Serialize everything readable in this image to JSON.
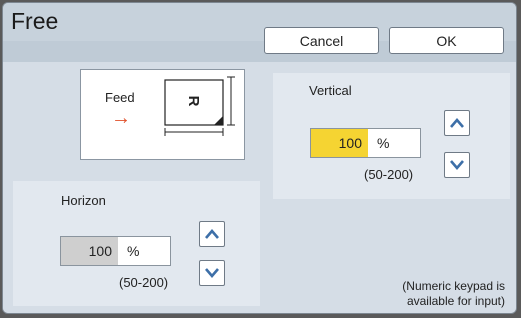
{
  "dialog": {
    "title": "Free",
    "cancel_label": "Cancel",
    "ok_label": "OK"
  },
  "diagram": {
    "feed_label": "Feed",
    "feed_arrow": "→",
    "paper_letter": "R"
  },
  "vertical": {
    "label": "Vertical",
    "value": "100",
    "unit": "%",
    "range": "(50-200)",
    "field_color": "#f5d432"
  },
  "horizontal": {
    "label": "Horizon",
    "value": "100",
    "unit": "%",
    "range": "(50-200)",
    "field_color": "#cfcfcf"
  },
  "note": {
    "line1": "(Numeric keypad is",
    "line2": "available for input)"
  },
  "icons": {
    "up": "chevron-up-icon",
    "down": "chevron-down-icon"
  }
}
